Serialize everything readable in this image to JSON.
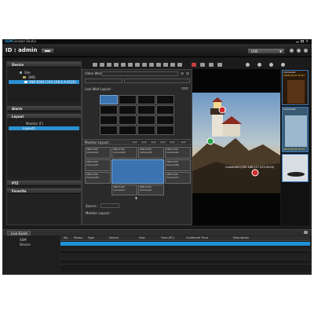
{
  "titlebar": {
    "brand": "SSM",
    "app_title": "Console Studio"
  },
  "header": {
    "id_label": "ID : admin",
    "mode": "LIVE"
  },
  "device_panel": {
    "title": "Device",
    "tree": [
      {
        "label": "Site",
        "depth": 0,
        "selected": false
      },
      {
        "label": "SMD",
        "depth": 1,
        "selected": false
      },
      {
        "label": "SNR-6004 (192.168.6.4:4520)",
        "depth": 2,
        "selected": true
      }
    ]
  },
  "alarm_panel": {
    "title": "Alarm"
  },
  "layout_panel": {
    "title": "Layout",
    "items": [
      {
        "label": "Monitor (F)",
        "selected": false
      },
      {
        "label": "Layout1",
        "selected": true
      }
    ]
  },
  "ptz_panel": {
    "title": "PTZ"
  },
  "favorite_panel": {
    "title": "Favorite"
  },
  "video_wall": {
    "label": "Video Wall",
    "last_layout_label": "Last Wall Layout :",
    "monitor_layout_label": "Monitor Layout :",
    "source_label": "Source :",
    "monitor_layout2_label": "Monitor Layout :"
  },
  "monitor_cells": [
    {
      "line1": "SNR-6100",
      "line2": "Camera01"
    },
    {
      "line1": "SNR-6100",
      "line2": "Camera02"
    },
    {
      "line1": "SNR-6100",
      "line2": "Camera03"
    },
    {
      "line1": "SNR-6100",
      "line2": "Camera04"
    },
    {
      "line1": "SNR-6100",
      "line2": "Camera07"
    },
    {
      "line1": "SNR-6100",
      "line2": "Camera08"
    },
    {
      "line1": "SNR-6100",
      "line2": "Camera09"
    },
    {
      "line1": "SNR-6100",
      "line2": "Camera10"
    },
    {
      "line1": "SNR-6100",
      "line2": "Camera11"
    },
    {
      "line1": "SNR-6100",
      "line2": "Camera12"
    }
  ],
  "camera_view": {
    "label": "Camera01 (192.168.217.253:4520)"
  },
  "thumbnails": [
    {
      "label": "Camera01",
      "sub": "2009-03-27 15:03"
    },
    {
      "label": "Camera02",
      "sub": "2013-03-29 10:31"
    },
    {
      "label": "",
      "sub": ""
    }
  ],
  "event_panel": {
    "tab": "Live Event",
    "tree": [
      {
        "label": "SSM"
      },
      {
        "label": "Device"
      }
    ],
    "columns": [
      "No.",
      "Status",
      "Type",
      "Device",
      "User",
      "Time (PC)",
      "Confirmed Time",
      "Description"
    ]
  },
  "colors": {
    "accent": "#1e90d6",
    "selected": "#2f6fa8",
    "background": "#1b1b1b"
  }
}
